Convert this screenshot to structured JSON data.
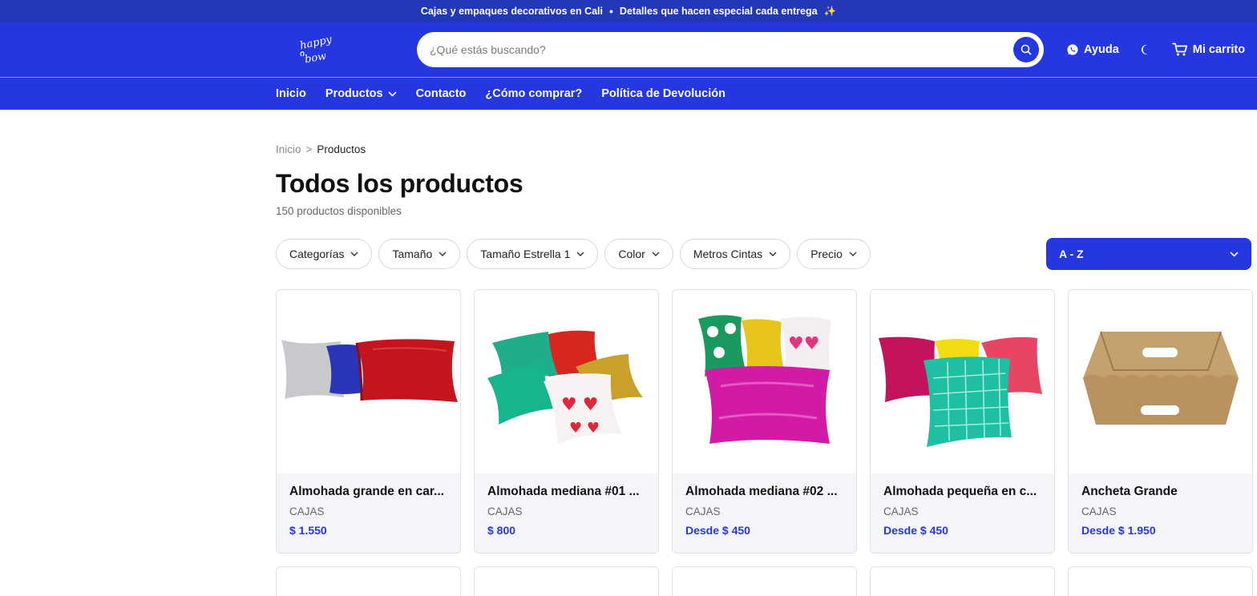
{
  "announcement": {
    "left": "Cajas y empaques decorativos en Cali",
    "separator": "•",
    "right": "Detalles que hacen especial cada entrega",
    "sparkle": "✨"
  },
  "header": {
    "logo_text": "happy bow",
    "search_placeholder": "¿Qué estás buscando?",
    "help_label": "Ayuda",
    "cart_label": "Mi carrito",
    "brand_color": "#2537e0"
  },
  "nav": {
    "items": [
      {
        "label": "Inicio"
      },
      {
        "label": "Productos"
      },
      {
        "label": "Contacto"
      },
      {
        "label": "¿Cómo comprar?"
      },
      {
        "label": "Política de Devolución"
      }
    ]
  },
  "breadcrumb": {
    "home": "Inicio",
    "separator": ">",
    "current": "Productos"
  },
  "page": {
    "title": "Todos los productos",
    "count": "150 productos disponibles"
  },
  "filters": [
    {
      "label": "Categorías"
    },
    {
      "label": "Tamaño"
    },
    {
      "label": "Tamaño Estrella 1"
    },
    {
      "label": "Color"
    },
    {
      "label": "Metros Cintas"
    },
    {
      "label": "Precio"
    }
  ],
  "sort": {
    "selected": "A - Z"
  },
  "products": [
    {
      "name": "Almohada grande en car...",
      "category": "CAJAS",
      "price": "$ 1.550"
    },
    {
      "name": "Almohada mediana #01 ...",
      "category": "CAJAS",
      "price": "$ 800"
    },
    {
      "name": "Almohada mediana #02 ...",
      "category": "CAJAS",
      "price": "Desde $ 450"
    },
    {
      "name": "Almohada pequeña en c...",
      "category": "CAJAS",
      "price": "Desde $ 450"
    },
    {
      "name": "Ancheta Grande",
      "category": "CAJAS",
      "price": "Desde $ 1.950"
    }
  ]
}
